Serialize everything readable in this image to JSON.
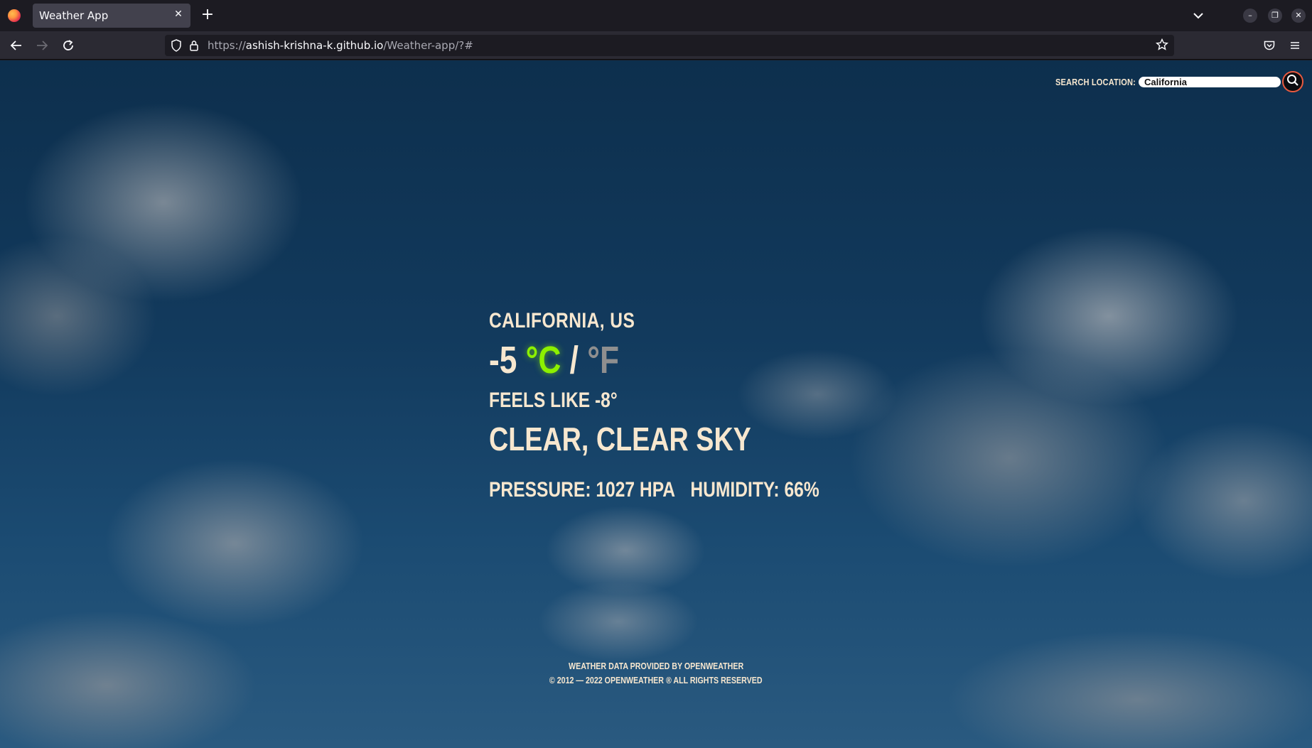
{
  "browser": {
    "tab_title": "Weather App",
    "url_host": "ashish-krishna-k.github.io",
    "url_path": "/Weather-app/?#",
    "url_scheme": "https://"
  },
  "search": {
    "label": "SEARCH LOCATION:",
    "value": "California"
  },
  "weather": {
    "location": "California, US",
    "temperature": "-5",
    "unit_celsius": "°C",
    "unit_separator": "/",
    "unit_fahrenheit": "°F",
    "feels_like": "Feels like -8°",
    "description": "Clear, clear sky",
    "pressure": "Pressure: 1027 hPa",
    "humidity": "Humidity: 66%"
  },
  "footer": {
    "line1": "Weather data provided by OpenWeather",
    "line2": "© 2012 — 2022 OpenWeather ® All rights reserved"
  },
  "colors": {
    "accent_celsius": "#8cf000",
    "text_cream": "#f7e7cf",
    "search_button_ring": "#e85a40"
  }
}
